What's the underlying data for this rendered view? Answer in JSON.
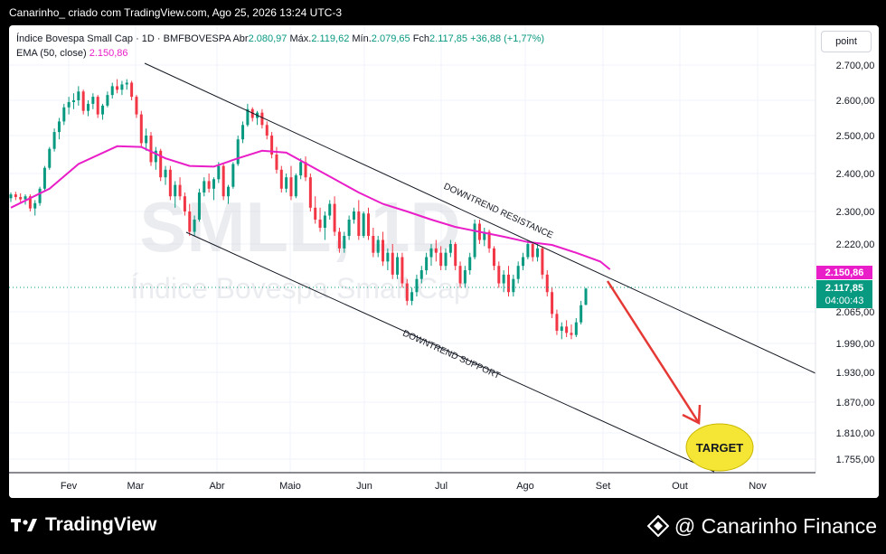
{
  "header": {
    "attribution": "Canarinho_ criado com TradingView.com, Ago 25, 2026 13:24 UTC-3"
  },
  "legend": {
    "symbol": "Índice Bovespa Small Cap · 1D · BMFBOVESPA",
    "open_label": "Abr",
    "open": "2.080,97",
    "high_label": "Máx.",
    "high": "2.119,62",
    "low_label": "Mín.",
    "low": "2.079,65",
    "close_label": "Fch",
    "close": "2.117,85",
    "change": "+36,88 (+1,77%)",
    "ema_label": "EMA (50, close)",
    "ema_value": "2.150,86"
  },
  "toolbar": {
    "scale_button": "point"
  },
  "watermark": {
    "ticker": "SMLL, 1D",
    "name": "Índice Bovespa Small Cap"
  },
  "price_tags": {
    "ema": "2.150,86",
    "last": "2.117,85",
    "countdown": "04:00:43"
  },
  "annotations": {
    "resistance": "DOWNTREND RESISTANCE",
    "support": "DOWNTREND SUPPORT",
    "target": "TARGET"
  },
  "colors": {
    "up": "#089981",
    "down": "#f23645",
    "ema": "#e91ec8",
    "target_fill": "#f5e535",
    "arrow": "#e53935",
    "axis_text": "#131722"
  },
  "footer": {
    "left_brand": "TradingView",
    "right_brand": "@ Canarinho Finance"
  },
  "chart_data": {
    "type": "candlestick",
    "y_ticks": [
      "2.700,00",
      "2.600,00",
      "2.500,00",
      "2.400,00",
      "2.300,00",
      "2.220,00",
      "2.065,00",
      "1.990,00",
      "1.930,00",
      "1.870,00",
      "1.810,00",
      "1.755,00"
    ],
    "x_ticks": [
      "Fev",
      "Mar",
      "Abr",
      "Maio",
      "Jun",
      "Jul",
      "Ago",
      "Set",
      "Out",
      "Nov"
    ],
    "ohlc": [
      [
        2335,
        2350,
        2325,
        2345
      ],
      [
        2345,
        2352,
        2330,
        2338
      ],
      [
        2338,
        2348,
        2325,
        2332
      ],
      [
        2332,
        2345,
        2318,
        2340
      ],
      [
        2340,
        2345,
        2300,
        2308
      ],
      [
        2308,
        2330,
        2290,
        2322
      ],
      [
        2322,
        2365,
        2315,
        2360
      ],
      [
        2360,
        2420,
        2355,
        2415
      ],
      [
        2415,
        2470,
        2410,
        2465
      ],
      [
        2465,
        2520,
        2458,
        2510
      ],
      [
        2510,
        2550,
        2490,
        2540
      ],
      [
        2540,
        2590,
        2530,
        2580
      ],
      [
        2580,
        2610,
        2560,
        2595
      ],
      [
        2595,
        2620,
        2575,
        2600
      ],
      [
        2600,
        2640,
        2585,
        2625
      ],
      [
        2625,
        2630,
        2560,
        2570
      ],
      [
        2570,
        2600,
        2555,
        2590
      ],
      [
        2590,
        2620,
        2575,
        2610
      ],
      [
        2610,
        2615,
        2550,
        2560
      ],
      [
        2560,
        2590,
        2545,
        2585
      ],
      [
        2585,
        2625,
        2580,
        2615
      ],
      [
        2615,
        2650,
        2605,
        2640
      ],
      [
        2640,
        2660,
        2620,
        2630
      ],
      [
        2630,
        2655,
        2615,
        2645
      ],
      [
        2645,
        2660,
        2630,
        2650
      ],
      [
        2650,
        2655,
        2600,
        2610
      ],
      [
        2610,
        2615,
        2550,
        2560
      ],
      [
        2560,
        2570,
        2470,
        2480
      ],
      [
        2480,
        2520,
        2460,
        2500
      ],
      [
        2500,
        2510,
        2420,
        2430
      ],
      [
        2430,
        2470,
        2410,
        2460
      ],
      [
        2460,
        2465,
        2380,
        2390
      ],
      [
        2390,
        2420,
        2370,
        2410
      ],
      [
        2410,
        2420,
        2330,
        2340
      ],
      [
        2340,
        2380,
        2310,
        2370
      ],
      [
        2370,
        2390,
        2330,
        2340
      ],
      [
        2340,
        2350,
        2290,
        2300
      ],
      [
        2300,
        2320,
        2240,
        2250
      ],
      [
        2250,
        2290,
        2240,
        2280
      ],
      [
        2280,
        2360,
        2275,
        2350
      ],
      [
        2350,
        2390,
        2340,
        2380
      ],
      [
        2380,
        2400,
        2350,
        2360
      ],
      [
        2360,
        2390,
        2330,
        2385
      ],
      [
        2385,
        2430,
        2375,
        2420
      ],
      [
        2420,
        2425,
        2330,
        2340
      ],
      [
        2340,
        2370,
        2320,
        2365
      ],
      [
        2365,
        2430,
        2360,
        2425
      ],
      [
        2425,
        2500,
        2420,
        2490
      ],
      [
        2490,
        2540,
        2480,
        2530
      ],
      [
        2530,
        2590,
        2525,
        2575
      ],
      [
        2575,
        2580,
        2540,
        2550
      ],
      [
        2550,
        2570,
        2530,
        2565
      ],
      [
        2565,
        2575,
        2520,
        2530
      ],
      [
        2530,
        2540,
        2490,
        2500
      ],
      [
        2500,
        2510,
        2440,
        2450
      ],
      [
        2450,
        2470,
        2400,
        2410
      ],
      [
        2410,
        2420,
        2350,
        2360
      ],
      [
        2360,
        2400,
        2350,
        2390
      ],
      [
        2390,
        2420,
        2330,
        2340
      ],
      [
        2340,
        2400,
        2335,
        2395
      ],
      [
        2395,
        2440,
        2385,
        2430
      ],
      [
        2430,
        2445,
        2380,
        2390
      ],
      [
        2390,
        2400,
        2300,
        2310
      ],
      [
        2310,
        2340,
        2270,
        2280
      ],
      [
        2280,
        2310,
        2250,
        2260
      ],
      [
        2260,
        2300,
        2230,
        2290
      ],
      [
        2290,
        2330,
        2280,
        2320
      ],
      [
        2320,
        2340,
        2240,
        2250
      ],
      [
        2250,
        2260,
        2200,
        2210
      ],
      [
        2210,
        2250,
        2200,
        2240
      ],
      [
        2240,
        2290,
        2230,
        2280
      ],
      [
        2280,
        2310,
        2270,
        2300
      ],
      [
        2300,
        2330,
        2230,
        2240
      ],
      [
        2240,
        2300,
        2235,
        2295
      ],
      [
        2295,
        2310,
        2230,
        2240
      ],
      [
        2240,
        2260,
        2190,
        2200
      ],
      [
        2200,
        2240,
        2190,
        2230
      ],
      [
        2230,
        2250,
        2170,
        2180
      ],
      [
        2180,
        2210,
        2160,
        2200
      ],
      [
        2200,
        2220,
        2140,
        2150
      ],
      [
        2150,
        2200,
        2140,
        2190
      ],
      [
        2190,
        2200,
        2120,
        2130
      ],
      [
        2130,
        2140,
        2080,
        2090
      ],
      [
        2090,
        2120,
        2080,
        2110
      ],
      [
        2110,
        2150,
        2100,
        2140
      ],
      [
        2140,
        2170,
        2130,
        2160
      ],
      [
        2160,
        2200,
        2150,
        2190
      ],
      [
        2190,
        2220,
        2170,
        2210
      ],
      [
        2210,
        2230,
        2180,
        2200
      ],
      [
        2200,
        2215,
        2160,
        2170
      ],
      [
        2170,
        2210,
        2160,
        2200
      ],
      [
        2200,
        2230,
        2190,
        2220
      ],
      [
        2220,
        2225,
        2160,
        2170
      ],
      [
        2170,
        2180,
        2120,
        2130
      ],
      [
        2130,
        2170,
        2120,
        2160
      ],
      [
        2160,
        2200,
        2150,
        2190
      ],
      [
        2190,
        2280,
        2185,
        2270
      ],
      [
        2270,
        2280,
        2220,
        2230
      ],
      [
        2230,
        2260,
        2215,
        2250
      ],
      [
        2250,
        2255,
        2200,
        2210
      ],
      [
        2210,
        2215,
        2160,
        2170
      ],
      [
        2170,
        2180,
        2120,
        2130
      ],
      [
        2130,
        2160,
        2110,
        2150
      ],
      [
        2150,
        2170,
        2100,
        2110
      ],
      [
        2110,
        2150,
        2100,
        2140
      ],
      [
        2140,
        2180,
        2130,
        2170
      ],
      [
        2170,
        2200,
        2160,
        2190
      ],
      [
        2190,
        2230,
        2185,
        2220
      ],
      [
        2220,
        2225,
        2180,
        2190
      ],
      [
        2190,
        2220,
        2180,
        2210
      ],
      [
        2210,
        2215,
        2140,
        2150
      ],
      [
        2150,
        2160,
        2100,
        2110
      ],
      [
        2110,
        2120,
        2050,
        2060
      ],
      [
        2060,
        2070,
        2010,
        2020
      ],
      [
        2020,
        2040,
        2000,
        2030
      ],
      [
        2030,
        2045,
        2005,
        2015
      ],
      [
        2015,
        2035,
        2000,
        2010
      ],
      [
        2010,
        2050,
        2005,
        2040
      ],
      [
        2040,
        2090,
        2035,
        2080
      ],
      [
        2081,
        2120,
        2080,
        2118
      ]
    ],
    "ema50": [
      [
        0,
        2310
      ],
      [
        8,
        2360
      ],
      [
        14,
        2425
      ],
      [
        22,
        2472
      ],
      [
        27,
        2470
      ],
      [
        32,
        2440
      ],
      [
        37,
        2420
      ],
      [
        42,
        2418
      ],
      [
        47,
        2440
      ],
      [
        52,
        2460
      ],
      [
        57,
        2455
      ],
      [
        62,
        2420
      ],
      [
        67,
        2385
      ],
      [
        72,
        2350
      ],
      [
        77,
        2320
      ],
      [
        82,
        2300
      ],
      [
        87,
        2280
      ],
      [
        92,
        2262
      ],
      [
        97,
        2250
      ],
      [
        102,
        2238
      ],
      [
        107,
        2225
      ],
      [
        112,
        2218
      ],
      [
        117,
        2200
      ],
      [
        122,
        2180
      ],
      [
        124,
        2162
      ]
    ]
  }
}
